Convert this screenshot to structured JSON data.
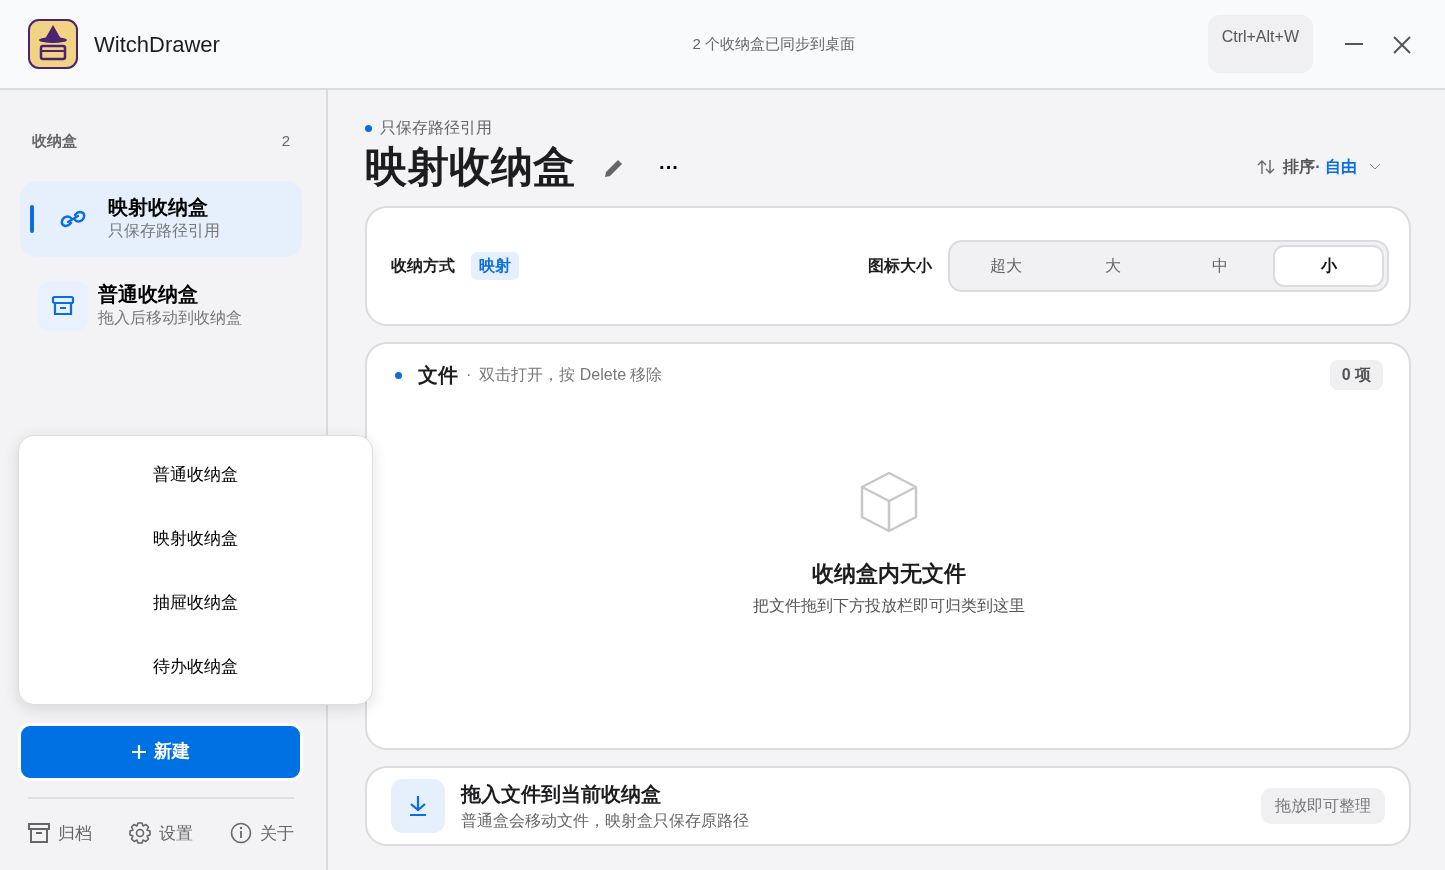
{
  "app": {
    "title": "WitchDrawer",
    "sync_status": "2 个收纳盒已同步到桌面",
    "shortcut": "Ctrl+Alt+W"
  },
  "sidebar": {
    "heading": "收纳盒",
    "count": "2",
    "items": [
      {
        "kind": "mapped",
        "title": "映射收纳盒",
        "subtitle": "只保存路径引用",
        "selected": true
      },
      {
        "kind": "normal",
        "title": "普通收纳盒",
        "subtitle": "拖入后移动到收纳盒",
        "selected": false
      }
    ],
    "new_button": "新建",
    "footer": [
      {
        "kind": "archive",
        "label": "归档"
      },
      {
        "kind": "settings",
        "label": "设置"
      },
      {
        "kind": "about",
        "label": "关于"
      }
    ]
  },
  "new_menu": {
    "items": [
      "普通收纳盒",
      "映射收纳盒",
      "抽屉收纳盒",
      "待办收纳盒"
    ]
  },
  "main": {
    "subtitle": "只保存路径引用",
    "title": "映射收纳盒",
    "more": "···",
    "sort": {
      "label": "排序·",
      "value": "自由"
    },
    "storage": {
      "label": "收纳方式",
      "badge": "映射"
    },
    "icon_size": {
      "label": "图标大小",
      "options": [
        {
          "label": "超大",
          "selected": false
        },
        {
          "label": "大",
          "selected": false
        },
        {
          "label": "中",
          "selected": false
        },
        {
          "label": "小",
          "selected": true
        }
      ]
    },
    "files": {
      "title": "文件",
      "separator": "·",
      "hint": "双击打开，按 Delete 移除",
      "count": "0 项",
      "empty_title": "收纳盒内无文件",
      "empty_text": "把文件拖到下方投放栏即可归类到这里"
    },
    "drop_zone": {
      "title": "拖入文件到当前收纳盒",
      "subtitle": "普通盒会移动文件，映射盒只保存原路径",
      "pill": "拖放即可整理"
    }
  }
}
